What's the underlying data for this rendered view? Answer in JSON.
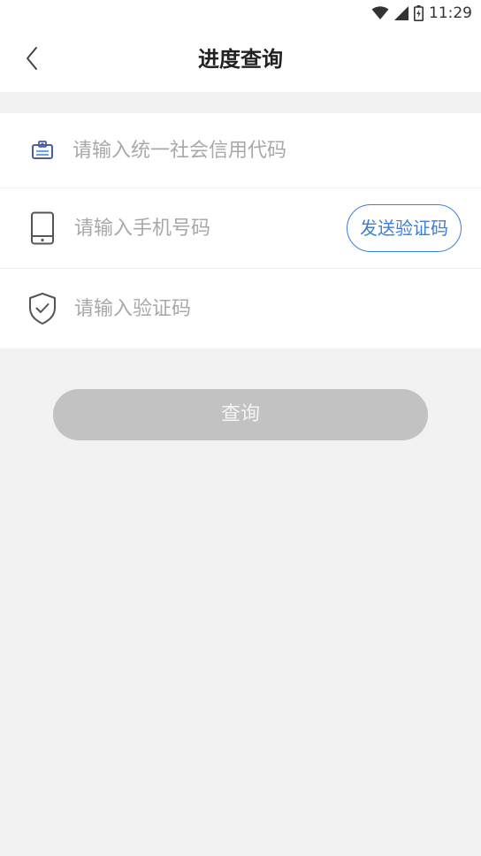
{
  "status_bar": {
    "time": "11:29",
    "icons": [
      "wifi-icon",
      "signal-icon",
      "battery-icon"
    ]
  },
  "header": {
    "title": "进度查询",
    "back_icon": "chevron-left-icon"
  },
  "form": {
    "credit_code": {
      "icon": "id-card-icon",
      "placeholder": "请输入统一社会信用代码"
    },
    "phone": {
      "icon": "phone-icon",
      "placeholder": "请输入手机号码",
      "send_code_label": "发送验证码"
    },
    "verify_code": {
      "icon": "shield-check-icon",
      "placeholder": "请输入验证码"
    }
  },
  "query_button": {
    "label": "查询",
    "state": "disabled"
  },
  "colors": {
    "accent": "#3b7fd6",
    "disabled_button": "#c2c2c2",
    "background": "#f2f2f2",
    "placeholder": "#a8a8a8",
    "icon_stroke": "#555555",
    "credit_icon": "#4a5f9c"
  }
}
